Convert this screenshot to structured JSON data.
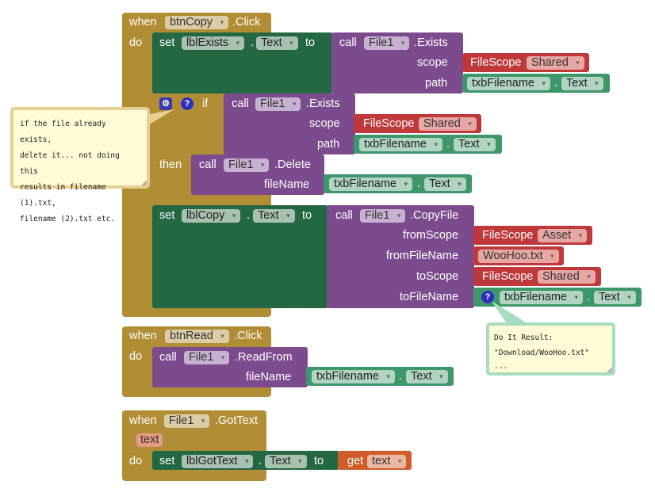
{
  "kw": {
    "when": "when",
    "do": "do",
    "set": "set",
    "to": "to",
    "call": "call",
    "if": "if",
    "then": "then",
    "get": "get",
    "dot": "."
  },
  "events": [
    {
      "component": "btnCopy",
      "event": ".Click",
      "statements": {
        "set_exists": {
          "component": "lblExists",
          "property": "Text",
          "call": {
            "component": "File1",
            "method": ".Exists",
            "args": [
              {
                "name": "scope",
                "value_type": "FileScope",
                "value": "Shared"
              },
              {
                "name": "path",
                "component": "txbFilename",
                "property": "Text"
              }
            ]
          }
        },
        "if_block": {
          "condition": {
            "component": "File1",
            "method": ".Exists",
            "args": [
              {
                "name": "scope",
                "value_type": "FileScope",
                "value": "Shared"
              },
              {
                "name": "path",
                "component": "txbFilename",
                "property": "Text"
              }
            ]
          },
          "then": {
            "component": "File1",
            "method": ".Delete",
            "args": [
              {
                "name": "fileName",
                "component": "txbFilename",
                "property": "Text"
              }
            ]
          }
        },
        "set_copy": {
          "component": "lblCopy",
          "property": "Text",
          "call": {
            "component": "File1",
            "method": ".CopyFile",
            "args": [
              {
                "name": "fromScope",
                "value_type": "FileScope",
                "value": "Asset"
              },
              {
                "name": "fromFileName",
                "value": "WooHoo.txt"
              },
              {
                "name": "toScope",
                "value_type": "FileScope",
                "value": "Shared"
              },
              {
                "name": "toFileName",
                "component": "txbFilename",
                "property": "Text"
              }
            ]
          }
        }
      }
    },
    {
      "component": "btnRead",
      "event": ".Click",
      "call": {
        "component": "File1",
        "method": ".ReadFrom",
        "args": [
          {
            "name": "fileName",
            "component": "txbFilename",
            "property": "Text"
          }
        ]
      }
    },
    {
      "component": "File1",
      "event": ".GotText",
      "param": "text",
      "set": {
        "component": "lblGotText",
        "property": "Text",
        "get": "text"
      }
    }
  ],
  "comments": {
    "if_comment": {
      "lines": [
        "if the file already exists,",
        "delete it... not doing this",
        "results in filename (1).txt,",
        "filename (2).txt etc."
      ]
    },
    "do_it_result": {
      "lines": [
        "Do It Result:",
        "\"Download/WooHoo.txt\"",
        "---"
      ]
    }
  },
  "colors": {
    "event": "#b18e35",
    "setter": "#236743",
    "call": "#7b4b8e",
    "scope": "#c0393a",
    "getter": "#3d976b",
    "variable": "#d05c2c",
    "comment_bg": "#fefcd6"
  }
}
